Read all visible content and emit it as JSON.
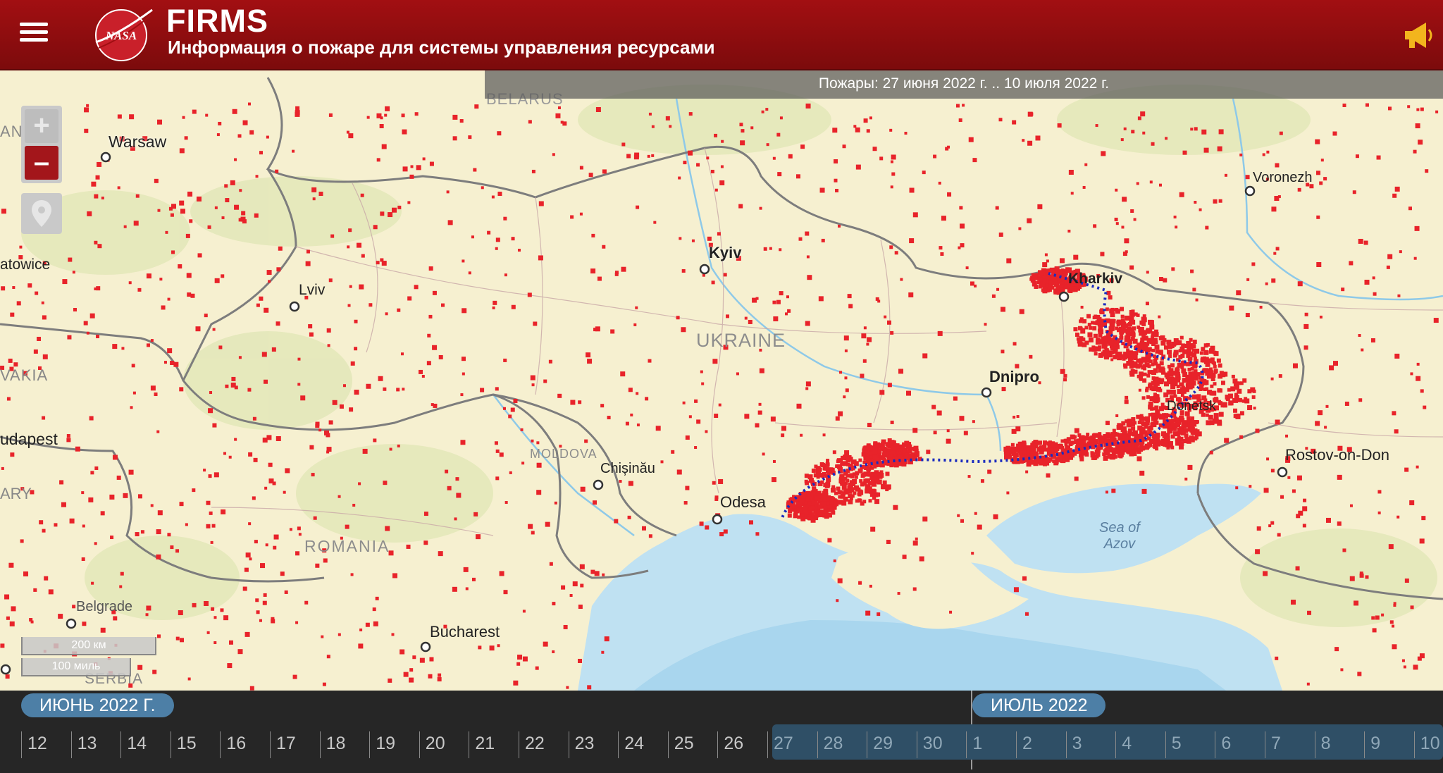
{
  "header": {
    "logo_text": "NASA",
    "title": "FIRMS",
    "subtitle": "Информация о пожаре для системы управления ресурсами",
    "menu_icon": "hamburger-icon",
    "announce_icon": "megaphone-icon",
    "bg_color": "#9b0e11"
  },
  "map": {
    "date_range": "Пожары: 27 июня 2022 г. .. 10 июля 2022 г.",
    "zoom_in_label": "+",
    "zoom_out_label": "–",
    "locate_icon": "map-pin-icon",
    "scale_km": "200 км",
    "scale_mi": "100 миль",
    "fire_color": "#e8232a",
    "frontline_color": "#1a2bbf",
    "labels": {
      "belarus": "BELARUS",
      "poland_partial": "AND",
      "warsaw": "Warsaw",
      "katowice_partial": "atowice",
      "lviv": "Lviv",
      "slovakia_partial": "VAKIA",
      "budapest_partial": "udapest",
      "hungary_partial": "ARY",
      "kyiv": "Kyiv",
      "ukraine": "UKRAINE",
      "kharkiv": "Kharkiv",
      "voronezh": "Voronezh",
      "dnipro": "Dnipro",
      "donetsk": "Donetsk",
      "rostov": "Rostov-on-Don",
      "moldova": "MOLDOVA",
      "chisinau": "Chișinău",
      "odesa": "Odesa",
      "romania": "ROMANIA",
      "bucharest": "Bucharest",
      "belgrade": "Belgrade",
      "serbia": "SERBIA",
      "sea_of_azov_1": "Sea of",
      "sea_of_azov_2": "Azov"
    }
  },
  "timeline": {
    "month_june": "ИЮНЬ 2022 Г.",
    "month_july": "ИЮЛЬ 2022",
    "days": [
      "12",
      "13",
      "14",
      "15",
      "16",
      "17",
      "18",
      "19",
      "20",
      "21",
      "22",
      "23",
      "24",
      "25",
      "26",
      "27",
      "28",
      "29",
      "30",
      "1",
      "2",
      "3",
      "4",
      "5",
      "6",
      "7",
      "8",
      "9",
      "10"
    ],
    "selected_from_index": 15
  }
}
